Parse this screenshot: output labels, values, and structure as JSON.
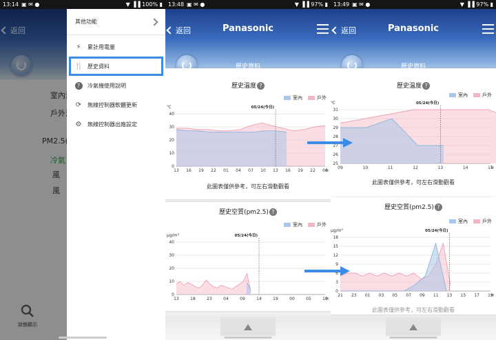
{
  "status": [
    {
      "time": "13:14",
      "battery": "100%"
    },
    {
      "time": "13:48",
      "battery": "97%"
    },
    {
      "time": "13:49",
      "battery": "97%"
    }
  ],
  "nav": {
    "back": "返回",
    "brand": "Panasonic",
    "page_title": "歷史資料"
  },
  "bg_screen": {
    "indoor": "室內溫",
    "outdoor": "戶外溫",
    "pm25": "PM2.5(",
    "mode": "冷氣",
    "wind1": "風",
    "wind2": "風",
    "status_label": "狀態顯示"
  },
  "drawer": {
    "header": "其他功能",
    "items": [
      {
        "label": "累計用電量",
        "icon": "bolt-icon"
      },
      {
        "label": "歷史資料",
        "icon": "utensils-icon"
      },
      {
        "label": "冷氣機使用說明",
        "icon": "help-icon"
      },
      {
        "label": "無線控制器軟體更新",
        "icon": "sync-icon"
      },
      {
        "label": "無線控制器出廠設定",
        "icon": "gear-icon"
      }
    ]
  },
  "cards": {
    "temp_title": "歷史溫度",
    "air_title": "歷史空質(pm2.5)",
    "legend_indoor": "室內",
    "legend_outdoor": "戶外",
    "note": "此圖表僅供參考，可左右滑動觀看",
    "unit_temp": "℃",
    "unit_air": "μg/m³"
  },
  "colors": {
    "indoor": "#a9c7ea",
    "outdoor": "#f4b6c2",
    "accent": "#3b8ce6"
  },
  "chart_data": [
    {
      "type": "area",
      "title": "歷史溫度",
      "ylabel": "℃",
      "xlabel": "H",
      "x_ticks": [
        "13",
        "16",
        "19",
        "22",
        "01",
        "04",
        "07",
        "10",
        "13",
        "16",
        "19",
        "22",
        "06"
      ],
      "today_label": "05/24(今日)",
      "today_index": 8,
      "ylim": [
        0,
        40
      ],
      "y_ticks": [
        0,
        10,
        20,
        30,
        40
      ],
      "series": [
        {
          "name": "室內",
          "values": [
            28,
            27,
            27,
            26,
            26,
            26,
            26,
            26,
            27,
            27,
            26
          ]
        },
        {
          "name": "戶外",
          "values": [
            29,
            29,
            28,
            28,
            27,
            27,
            28,
            31,
            33,
            31,
            29,
            27,
            28,
            30,
            31
          ]
        }
      ]
    },
    {
      "type": "area",
      "title": "歷史空質(pm2.5)",
      "ylabel": "μg/m³",
      "xlabel": "H",
      "x_ticks": [
        "13",
        "18",
        "23",
        "04",
        "09",
        "14",
        "19",
        "00",
        "05",
        "10"
      ],
      "today_label": "05/24(今日)",
      "today_index": 5,
      "ylim": [
        0,
        40
      ],
      "y_ticks": [
        0,
        10,
        20,
        30,
        40
      ],
      "series": [
        {
          "name": "室內",
          "values": [
            9,
            4
          ]
        },
        {
          "name": "戶外",
          "values": [
            8,
            10,
            7,
            9,
            8,
            6,
            5,
            7,
            11,
            8,
            6,
            5,
            7,
            6,
            5,
            4,
            6,
            8,
            10,
            16,
            2
          ]
        }
      ]
    },
    {
      "type": "area",
      "title": "歷史溫度",
      "ylabel": "℃",
      "xlabel": "H",
      "x_ticks": [
        "09",
        "10",
        "11",
        "12",
        "13",
        "14",
        "15"
      ],
      "today_label": "05/24(今日)",
      "today_index": 4,
      "ylim": [
        25,
        31
      ],
      "y_ticks": [
        25,
        26,
        27,
        28,
        29,
        30,
        31
      ],
      "series": [
        {
          "name": "室內",
          "values": [
            29,
            29,
            30,
            27,
            27
          ]
        },
        {
          "name": "戶外",
          "values": [
            29.5,
            30,
            30.5,
            31,
            32,
            32,
            31,
            30
          ]
        }
      ]
    },
    {
      "type": "area",
      "title": "歷史空質(pm2.5)",
      "ylabel": "μg/m³",
      "xlabel": "H",
      "x_ticks": [
        "21",
        "23",
        "01",
        "03",
        "05",
        "07",
        "09",
        "11",
        "13",
        "15",
        "17",
        "19"
      ],
      "today_label": "05/24(今日)",
      "today_index": 8,
      "ylim": [
        0,
        18
      ],
      "y_ticks": [
        0,
        3,
        6,
        9,
        12,
        15,
        18
      ],
      "series": [
        {
          "name": "室內",
          "values": [
            0,
            0,
            0,
            0,
            0,
            0,
            0,
            2,
            5,
            16,
            0
          ]
        },
        {
          "name": "戶外",
          "values": [
            5,
            6,
            6,
            5,
            6,
            5,
            6,
            5,
            6,
            5,
            6,
            4,
            5,
            9,
            16,
            2
          ]
        }
      ]
    }
  ]
}
